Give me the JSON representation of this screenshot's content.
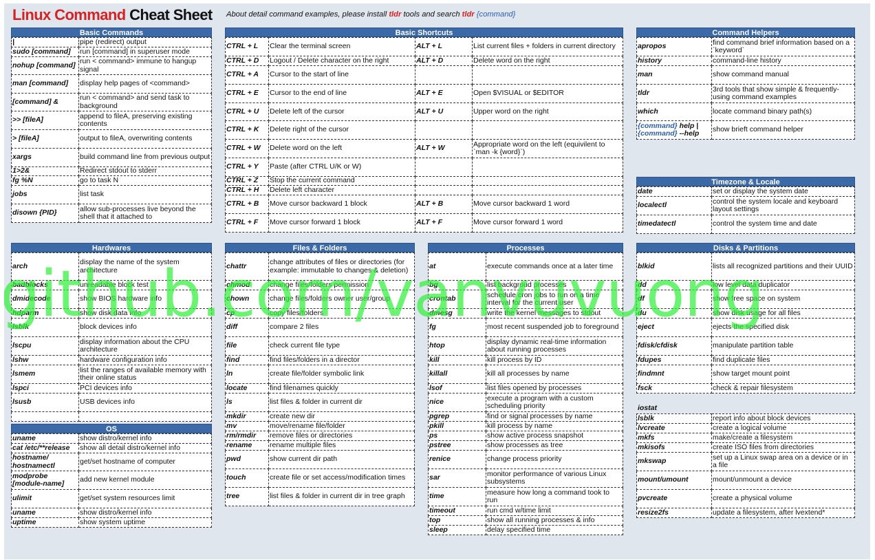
{
  "title": {
    "part1": "Linux Command",
    "part2": "Cheat Sheet"
  },
  "subtitle": {
    "p1": "About detail command examples, please install ",
    "tldr1": "tldr",
    "p2": " tools and search ",
    "tldr2": "tldr",
    "cmd": "{command}"
  },
  "watermark": "github.com/vanvuvuong",
  "sections": {
    "basic_commands": {
      "title": "Basic Commands",
      "rows": [
        {
          "k": "|",
          "v": "pipe (redirect) output",
          "h": 14
        },
        {
          "k": "sudo [command]",
          "v": "run [command] in superuser mode",
          "h": 14
        },
        {
          "k": "nohup [command]",
          "v": "run < command> immune to hangup signal",
          "h": 26
        },
        {
          "k": "man [command]",
          "v": "display help pages of <command>",
          "h": 27
        },
        {
          "k": "[command] &",
          "v": "run < command> and send task to background",
          "h": 26
        },
        {
          "k": ">> [fileA]",
          "v": "append to fileA, preserving existing contents",
          "h": 27
        },
        {
          "k": "> [fileA]",
          "v": "output to fileA, overwriting contents",
          "h": 27
        },
        {
          "k": "xargs",
          "v": "build command line from previous output",
          "h": 27
        },
        {
          "k": "1>2&",
          "v": "Redirect stdout to stderr",
          "h": 13
        },
        {
          "k": "fg %N",
          "v": "go to task N",
          "h": 14
        },
        {
          "k": "jobs",
          "v": "list task",
          "h": 27
        },
        {
          "k": "disown {PID}",
          "v": "allow sub-processes live beyond the shell that it attached to",
          "h": 27
        }
      ]
    },
    "basic_shortcuts": {
      "title": "Basic Shortcuts",
      "rows": [
        {
          "k1": "CTRL + L",
          "v1": "Clear the terminal screen",
          "k2": "ALT + L",
          "v2": "List current files + folders in current directory",
          "h": 27
        },
        {
          "k1": "CTRL + D",
          "v1": "Logout / Delete character on the right",
          "k2": "ALT + D",
          "v2": "Delete word on the right",
          "h": 14
        },
        {
          "k1": "CTRL + A",
          "v1": "Cursor to the start of line",
          "k2": "",
          "v2": "",
          "h": 27
        },
        {
          "k1": "CTRL + E",
          "v1": "Cursor to the end of line",
          "k2": "ALT + E",
          "v2": "Open $VISUAL or $EDITOR",
          "h": 27
        },
        {
          "k1": "CTRL + U",
          "v1": "Delete left of the cursor",
          "k2": "ALT + U",
          "v2": "Upper word on the right",
          "h": 26
        },
        {
          "k1": "CTRL + K",
          "v1": "Delete right of the cursor",
          "k2": "",
          "v2": "",
          "h": 27
        },
        {
          "k1": "CTRL + W",
          "v1": "Delete word on the left",
          "k2": "ALT + W",
          "v2": "Appropriate word on the left (equivilent to `man -k {word}`)",
          "h": 27
        },
        {
          "k1": "CTRL + Y",
          "v1": "Paste (after CTRL U/K or W)",
          "k2": "",
          "v2": "",
          "h": 27
        },
        {
          "k1": "CTRL + Z",
          "v1": "Stop the current command",
          "k2": "",
          "v2": "",
          "h": 13
        },
        {
          "k1": "CTRL + H",
          "v1": "Delete left character",
          "k2": "",
          "v2": "",
          "h": 14
        },
        {
          "k1": "CTRL + B",
          "v1": "Move cursor backward 1 block",
          "k2": "ALT + B",
          "v2": "Move cursor backward 1 word",
          "h": 27
        },
        {
          "k1": "CTRL + F",
          "v1": "Move cursor forward 1 block",
          "k2": "ALT + F",
          "v2": "Move cursor forward 1 word",
          "h": 27
        }
      ]
    },
    "command_helpers": {
      "title": "Command Helpers",
      "rows": [
        {
          "k": "apropos",
          "v": "find command brief information based on a `keyword`",
          "h": 27
        },
        {
          "k": "history",
          "v": "command-line history",
          "h": 14
        },
        {
          "k": "man",
          "v": "show command manual",
          "h": 27
        },
        {
          "k": "tldr",
          "v": "3rd tools that show simple & frequently-using command examples",
          "h": 27
        },
        {
          "k": "which",
          "v": "locate command binary path(s)",
          "h": 26
        },
        {
          "k": "",
          "kb1": "{command}",
          "kt1": " help |",
          "kb2": "{command}",
          "kt2": " --help",
          "v": "show brieft command helper",
          "h": 27
        }
      ]
    },
    "timezone_locale": {
      "title": "Timezone & Locale",
      "rows": [
        {
          "k": "date",
          "v": "set or display the system date",
          "h": 14
        },
        {
          "k": "localectl",
          "v": "control the system locale and keyboard layout settings",
          "h": 27
        },
        {
          "k": "timedatectl",
          "v": "control the system time and date",
          "h": 27
        }
      ]
    },
    "hardwares": {
      "title": "Hardwares",
      "rows": [
        {
          "k": "arch",
          "v": "display the name of the system architecture",
          "h": 40
        },
        {
          "k": "badblocks",
          "v": "unreadable block test",
          "h": 14
        },
        {
          "k": "dmidecode",
          "v": "show BIOS hardware info",
          "h": 27
        },
        {
          "k": "hdparm",
          "v": "show disk data info",
          "h": 14
        },
        {
          "k": "lsblk",
          "v": "block devices info",
          "h": 27
        },
        {
          "k": "lscpu",
          "v": "display information about the CPU architecture",
          "h": 27
        },
        {
          "k": "lshw",
          "v": "hardware configuration info",
          "h": 14
        },
        {
          "k": "lsmem",
          "v": "list the ranges of available memory with their online status",
          "h": 27
        },
        {
          "k": "lspci",
          "v": "PCI devices info",
          "h": 14
        },
        {
          "k": "lsusb",
          "v": "USB devices info",
          "h": 27
        },
        {
          "k": "",
          "v": "",
          "h": 14
        }
      ]
    },
    "os": {
      "title": "OS",
      "rows": [
        {
          "k": "uname",
          "v": "show distro/kernel info",
          "h": 14
        },
        {
          "k": "cat /etc/**release",
          "v": "show all detail distro/kernel info",
          "h": 14
        },
        {
          "k": "hostname/ hostnamectl",
          "v": "get/set hostname of computer",
          "h": 26
        },
        {
          "k": "modprobe [module-name]",
          "v": "add new kernel module",
          "h": 27
        },
        {
          "k": "ulimit",
          "v": "get/set system resources limit",
          "h": 27
        },
        {
          "k": "uname",
          "v": "show distro/kernel info",
          "h": 14
        },
        {
          "k": "uptime",
          "v": "show system uptime",
          "h": 14
        }
      ]
    },
    "files_folders": {
      "title": "Files & Folders",
      "rows": [
        {
          "k": "chattr",
          "v": "change attributes of files or directories (for example: immutable to changes & deletion)",
          "h": 40
        },
        {
          "k": "chmod",
          "v": "change files/folders permission",
          "h": 14
        },
        {
          "k": "chown",
          "v": "change files/folders owner user/group",
          "h": 27
        },
        {
          "k": "cp",
          "v": "copy files/folders",
          "h": 14
        },
        {
          "k": "diff",
          "v": "compare 2 files",
          "h": 27
        },
        {
          "k": "file",
          "v": "check current file type",
          "h": 27
        },
        {
          "k": "find",
          "v": "find files/folders in a director",
          "h": 14
        },
        {
          "k": "ln",
          "v": "create file/folder symbolic link",
          "h": 27
        },
        {
          "k": "locate",
          "v": "find filenames quickly",
          "h": 14
        },
        {
          "k": "ls",
          "v": "list files & folder in current dir",
          "h": 27
        },
        {
          "k": "mkdir",
          "v": "create new dir",
          "h": 14
        },
        {
          "k": "mv",
          "v": "move/rename file/folder",
          "h": 14
        },
        {
          "k": "rm/rmdir",
          "v": "remove files or directories",
          "h": 14
        },
        {
          "k": "rename",
          "v": "rename multiple files",
          "h": 14
        },
        {
          "k": "pwd",
          "v": "show current dir path",
          "h": 27
        },
        {
          "k": "touch",
          "v": "create file or set access/modification times",
          "h": 27
        },
        {
          "k": "tree",
          "v": "list files & folder in current dir in tree graph",
          "h": 27
        }
      ]
    },
    "processes": {
      "title": "Processes",
      "rows": [
        {
          "k": "at",
          "v": "execute commands once at a later time",
          "h": 40
        },
        {
          "k": "bg",
          "v": "list backgroud processes",
          "h": 14
        },
        {
          "k": "crontab",
          "v": "schedule cron jobs to run on a time interval for the current user",
          "h": 27
        },
        {
          "k": "dmesg",
          "v": "write the kernel messages to stdout",
          "h": 14
        },
        {
          "k": "fg",
          "v": "most recent suspended job to foreground",
          "h": 27
        },
        {
          "k": "htop",
          "v": "display dynamic real-time information about running processes",
          "h": 27
        },
        {
          "k": "kill",
          "v": "kill process by ID",
          "h": 14
        },
        {
          "k": "killall",
          "v": "kill all processes by name",
          "h": 27
        },
        {
          "k": "lsof",
          "v": "list files opened by processes",
          "h": 14
        },
        {
          "k": "nice",
          "v": "execute a program with a custom scheduling priority",
          "h": 27
        },
        {
          "k": "pgrep",
          "v": "find or signal processes by name",
          "h": 14
        },
        {
          "k": "pkill",
          "v": "kill process by name",
          "h": 14
        },
        {
          "k": "ps",
          "v": "show active process snapshot",
          "h": 14
        },
        {
          "k": "pstree",
          "v": "show processes as tree",
          "h": 14
        },
        {
          "k": "renice",
          "v": "change process priority",
          "h": 27
        },
        {
          "k": "sar",
          "v": "monitor performance of various Linux subsystems",
          "h": 27
        },
        {
          "k": "time",
          "v": "measure how long a command took to run",
          "h": 27
        },
        {
          "k": "timeout",
          "v": "run cmd w/time limit",
          "h": 14
        },
        {
          "k": "top",
          "v": "show all running processes & info",
          "h": 14
        },
        {
          "k": "sleep",
          "v": "delay specified time",
          "h": 14
        }
      ]
    },
    "disks_partitions": {
      "title": "Disks & Partitions",
      "rows": [
        {
          "k": "blkid",
          "v": "lists all recognized partitions and their UUID",
          "h": 40
        },
        {
          "k": "dd",
          "v": "low level data duplicator",
          "h": 14
        },
        {
          "k": "df",
          "v": "show free space on system",
          "h": 27
        },
        {
          "k": "du",
          "v": "show disk usage for all files",
          "h": 14
        },
        {
          "k": "eject",
          "v": "ejects the specified disk",
          "h": 27
        },
        {
          "k": "fdisk/cfdisk",
          "v": "manipulate partition table",
          "h": 27
        },
        {
          "k": "fdupes",
          "v": "find duplicate files",
          "h": 14
        },
        {
          "k": "findmnt",
          "v": "show target mount point",
          "h": 27
        },
        {
          "k": "fsck",
          "v": "check & repair filesystem",
          "h": 14
        }
      ]
    },
    "iostat": {
      "label": "iostat",
      "rows": [
        {
          "k": "lsblk",
          "v": "report info about block devices",
          "h": 14
        },
        {
          "k": "lvcreate",
          "v": "create a logical volume",
          "h": 14
        },
        {
          "k": "mkfs",
          "v": "make/create a filesystem",
          "h": 14
        },
        {
          "k": "mkisofs",
          "v": "create ISO files from directories",
          "h": 14
        },
        {
          "k": "mkswap",
          "v": "set up a Linux swap area on a device or in a file",
          "h": 27
        },
        {
          "k": "mount/umount",
          "v": "mount/unmount a device",
          "h": 27
        },
        {
          "k": "pvcreate",
          "v": "create a physical volume",
          "h": 27
        },
        {
          "k": "resize2fs",
          "v": "update a filesystem, after lvextend*",
          "h": 14
        }
      ]
    }
  }
}
